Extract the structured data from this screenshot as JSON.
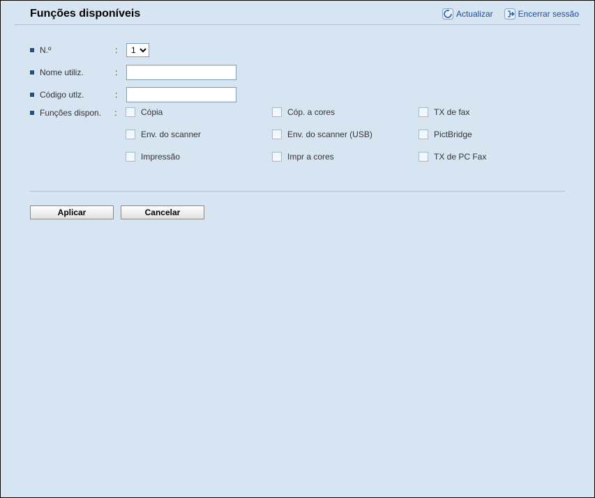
{
  "header": {
    "title": "Funções disponíveis",
    "refresh_label": "Actualizar",
    "logout_label": "Encerrar sessão"
  },
  "form": {
    "number_label": "N.º",
    "number_value": "1",
    "username_label": "Nome utiliz.",
    "username_value": "",
    "usercode_label": "Código utlz.",
    "usercode_value": "",
    "functions_label": "Funções dispon."
  },
  "functions": {
    "r0c0": "Cópia",
    "r0c1": "Cóp. a cores",
    "r0c2": "TX de fax",
    "r1c0": "Env. do scanner",
    "r1c1": "Env. do scanner (USB)",
    "r1c2": "PictBridge",
    "r2c0": "Impressão",
    "r2c1": "Impr a cores",
    "r2c2": "TX de PC Fax"
  },
  "buttons": {
    "apply": "Aplicar",
    "cancel": "Cancelar"
  }
}
